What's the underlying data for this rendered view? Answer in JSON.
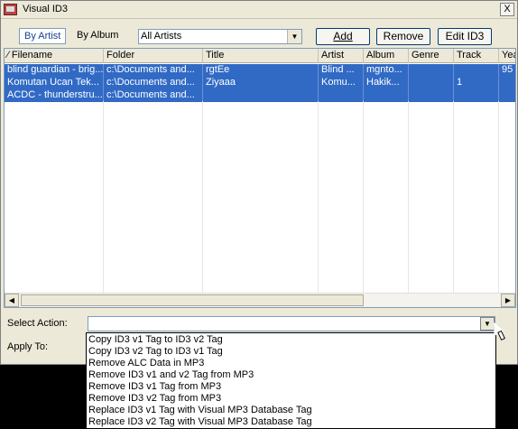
{
  "window": {
    "title": "Visual ID3",
    "close_label": "X"
  },
  "tabs": [
    {
      "label": "By Artist",
      "active": true
    },
    {
      "label": "By Album",
      "active": false
    }
  ],
  "artist_filter": {
    "selected": "All Artists"
  },
  "buttons": {
    "add": "Add",
    "remove": "Remove",
    "edit": "Edit ID3"
  },
  "columns": [
    "Filename",
    "Folder",
    "Title",
    "Artist",
    "Album",
    "Genre",
    "Track",
    "Yea"
  ],
  "rows": [
    [
      "blind guardian - brig...",
      "c:\\Documents and...",
      "rgtEe",
      "Blind ...",
      "mgnto...",
      "",
      "",
      "95"
    ],
    [
      "Komutan Ucan Tek...",
      "c:\\Documents and...",
      "Ziyaaa",
      "Komu...",
      "Hakik...",
      "",
      "1",
      ""
    ],
    [
      "ACDC - thunderstru...",
      "c:\\Documents and...",
      "",
      "",
      "",
      "",
      "",
      ""
    ]
  ],
  "select_action": {
    "label": "Select Action:",
    "value": ""
  },
  "apply_to": {
    "label": "Apply To:"
  },
  "action_options": [
    "Copy ID3 v1 Tag to ID3 v2 Tag",
    "Copy ID3 v2 Tag to ID3 v1 Tag",
    "Remove ALC Data in MP3",
    "Remove ID3 v1 and v2 Tag from MP3",
    "Remove ID3 v1 Tag from MP3",
    "Remove ID3 v2 Tag from MP3",
    "Replace ID3 v1 Tag with Visual MP3 Database Tag",
    "Replace ID3 v2 Tag with Visual MP3 Database Tag"
  ],
  "colors": {
    "selection": "#316ac5",
    "window_bg": "#ece9d8"
  }
}
